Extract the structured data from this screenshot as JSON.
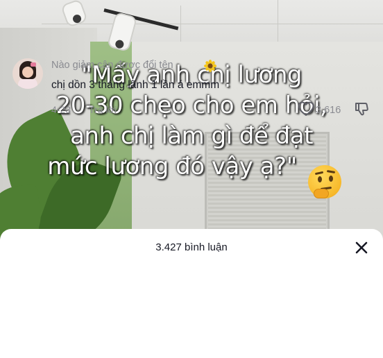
{
  "video": {
    "caption_lines": [
      "\"Mấy anh chị lương",
      "20-30 chẹo cho em hỏi,",
      "anh chị làm gì để đạt",
      "mức lương đó vậy ạ?\""
    ],
    "caption_emoji": "thinking-face-icon"
  },
  "comments_panel": {
    "title": "3.427 bình luận",
    "close_icon": "close-icon"
  },
  "comment": {
    "username": "Nào giảm cân được đổi tên",
    "username_emoji": "sunflower-icon",
    "text": "chị dồn 3 tháng lãnh 1 lần á emmm",
    "date": "4-23",
    "reply_label": "Trả lời",
    "like_count": "3.616",
    "like_icon": "heart-outline-icon",
    "dislike_icon": "thumbs-down-icon"
  },
  "colors": {
    "text_primary": "#161823",
    "text_secondary": "#8a8b91",
    "sheet_background": "#ffffff"
  }
}
